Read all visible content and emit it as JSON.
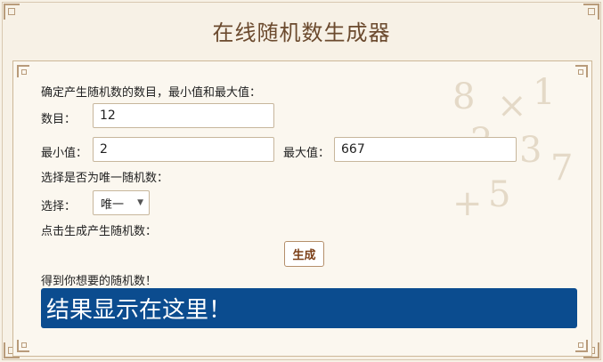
{
  "header": {
    "title": "在线随机数生成器"
  },
  "form": {
    "intro": "确定产生随机数的数目，最小值和最大值：",
    "count_label": "数目：",
    "count_value": "12",
    "min_label": "最小值：",
    "min_value": "2",
    "max_label": "最大值：",
    "max_value": "667",
    "unique_prompt": "选择是否为唯一随机数：",
    "select_label": "选择：",
    "select_value": "唯一",
    "generate_prompt": "点击生成产生随机数：",
    "generate_button": "生成",
    "result_prompt": "得到你想要的随机数！",
    "result_text": "结果显示在这里！"
  },
  "colors": {
    "accent": "#0b4c8f",
    "title": "#6b4a2e",
    "button_text": "#7a3e17"
  }
}
